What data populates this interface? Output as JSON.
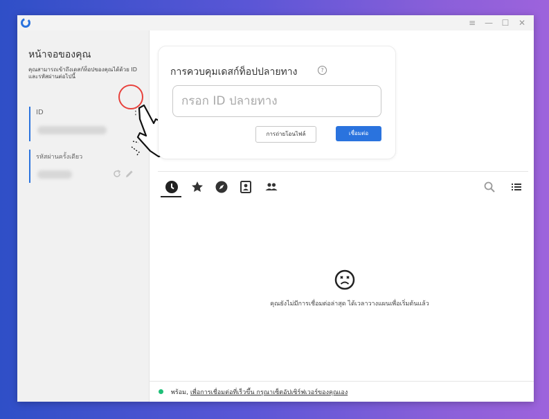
{
  "window": {
    "logo_icon": "app-logo-icon",
    "controls": [
      "menu-icon",
      "minimize-icon",
      "maximize-icon",
      "close-icon"
    ]
  },
  "sidebar": {
    "title": "หน้าจอของคุณ",
    "description": "คุณสามารถเข้าถึงเดสก์ท็อปของคุณได้ด้วย ID และรหัสผ่านต่อไปนี้",
    "id_label": "ID",
    "id_menu_icon": "more-vertical-icon",
    "password_label": "รหัสผ่านครั้งเดียว",
    "password_icons": [
      "refresh-icon",
      "edit-icon"
    ]
  },
  "remote_control": {
    "title": "การควบคุมเดสก์ท็อปปลายทาง",
    "help_icon": "help-icon",
    "input_placeholder": "กรอก ID ปลายทาง",
    "input_value": "",
    "transfer_button": "การถ่ายโอนไฟล์",
    "connect_button": "เชื่อมต่อ"
  },
  "tabs": [
    {
      "icon": "clock-icon",
      "active": true
    },
    {
      "icon": "star-icon",
      "active": false
    },
    {
      "icon": "compass-icon",
      "active": false
    },
    {
      "icon": "address-book-icon",
      "active": false
    },
    {
      "icon": "group-icon",
      "active": false
    }
  ],
  "toolbar_icons": [
    "search-icon",
    "list-view-icon"
  ],
  "empty_state": {
    "icon": "sad-face-icon",
    "text": "คุณยังไม่มีการเชื่อมต่อล่าสุด ได้เวลาวางแผนเพื่อเริ่มต้นแล้ว"
  },
  "status": {
    "prefix": "พร้อม,",
    "link_text": "เพื่อการเชื่อมต่อที่เร็วขึ้น กรุณาเซ็ตอัปเซิร์ฟเวอร์ของคุณเอง",
    "color": "#1fbf78"
  },
  "colors": {
    "accent": "#2a73de",
    "highlight": "#e8413c"
  }
}
